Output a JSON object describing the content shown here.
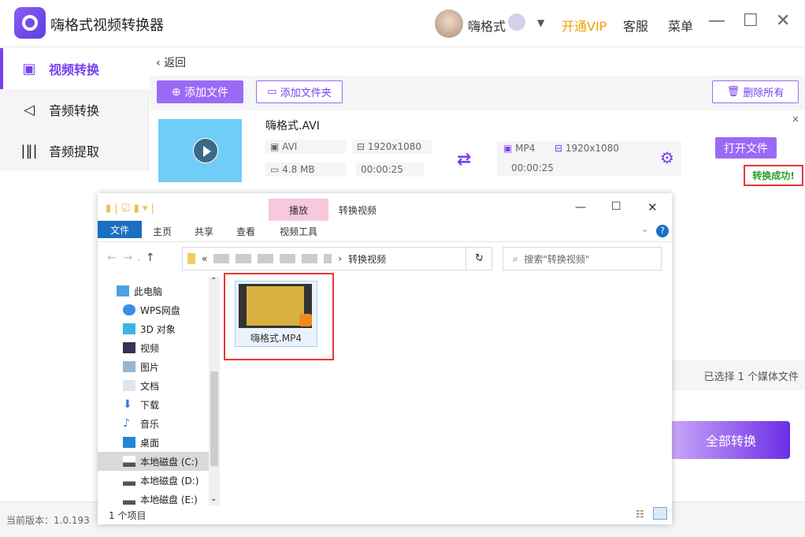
{
  "app": {
    "title": "嗨格式视频转换器",
    "username": "嗨格式",
    "vip": "开通VIP",
    "service": "客服",
    "menu": "菜单",
    "minimize": "—",
    "maximize": "☐",
    "close": "✕",
    "version": "当前版本：1.0.193"
  },
  "sidebar": {
    "items": [
      {
        "label": "视频转换",
        "icon": "video-convert-icon"
      },
      {
        "label": "音频转换",
        "icon": "audio-convert-icon"
      },
      {
        "label": "音频提取",
        "icon": "audio-extract-icon"
      }
    ]
  },
  "main": {
    "back": "返回",
    "add_file": "添加文件",
    "add_folder": "添加文件夹",
    "delete_all": "删除所有",
    "file": {
      "name": "嗨格式.AVI",
      "format": "AVI",
      "resolution": "1920x1080",
      "size": "4.8 MB",
      "duration": "00:00:25"
    },
    "output": {
      "format": "MP4",
      "resolution": "1920x1080",
      "duration": "00:00:25"
    },
    "open_file": "打开文件",
    "status": "转换成功!",
    "remove": "×",
    "selected": "已选择 1 个媒体文件",
    "convert_all": "全部转换"
  },
  "explorer": {
    "context_tab": "播放",
    "title": "转换视频",
    "tabs": [
      "文件",
      "主页",
      "共享",
      "查看",
      "视频工具"
    ],
    "path_prefix": "«",
    "path_current": "转换视频",
    "search_placeholder": "搜索\"转换视频\"",
    "nav": [
      "此电脑",
      "WPS网盘",
      "3D 对象",
      "视频",
      "图片",
      "文档",
      "下载",
      "音乐",
      "桌面",
      "本地磁盘 (C:)",
      "本地磁盘 (D:)",
      "本地磁盘 (E:)"
    ],
    "file": "嗨格式.MP4",
    "count": "1 个项目",
    "accent": "#1a6fc1"
  },
  "colors": {
    "accent": "#9b6af5",
    "success": "#2e9d2e",
    "highlight": "#e53935"
  }
}
